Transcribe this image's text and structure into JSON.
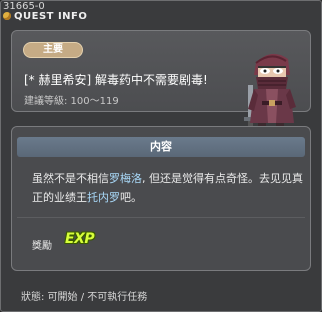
{
  "window": {
    "quest_id": "31665-0",
    "title": "QUEST INFO"
  },
  "header": {
    "badge": "主要",
    "quest_title": "[* 赫里希安] 解毒药中不需要剧毒!",
    "level": "建議等級: 100～119"
  },
  "content": {
    "heading": "内容",
    "text_1": "虽然不是不相信",
    "name_1": "罗梅洛",
    "text_2": ", 但还是觉得有点奇怪。去见见真正的业绩王",
    "name_2": "托内罗",
    "text_3": "吧。"
  },
  "reward": {
    "label": "獎勵",
    "exp": "EXP"
  },
  "status": "狀態: 可開始 / 不可執行任務",
  "colors": {
    "highlight": "#a8d8f8",
    "badge": "#c5ab85"
  }
}
